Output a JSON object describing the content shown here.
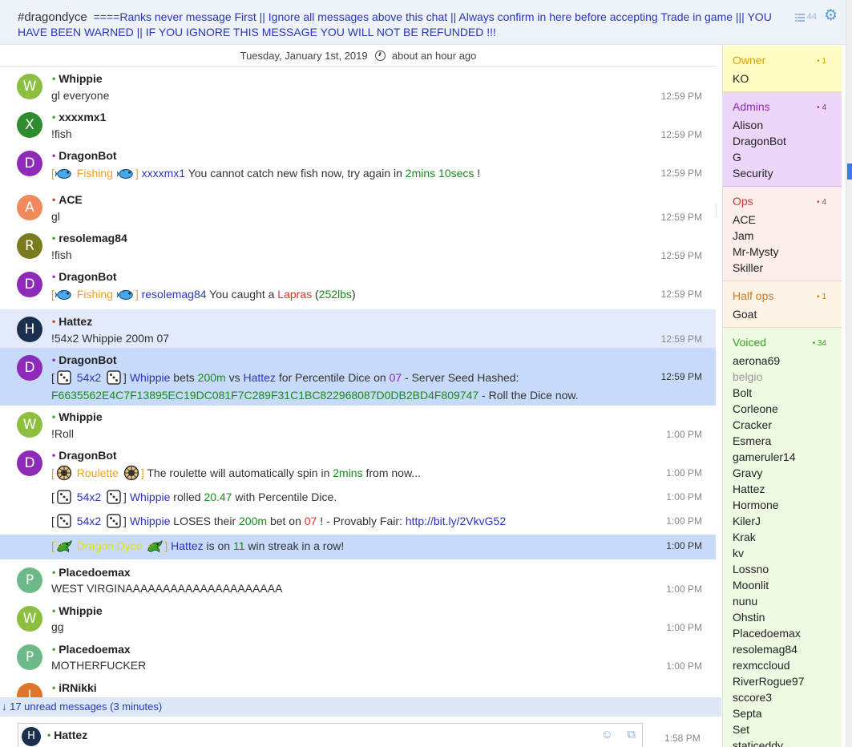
{
  "topic": {
    "channel": "#dragondyce",
    "text": "====Ranks never message First || Ignore all messages above this chat || Always confirm in here before accepting Trade in game ||| YOU HAVE BEEN WARNED || IF YOU IGNORE THIS MESSAGE YOU WILL NOT BE REFUNDED !!!",
    "user_count": "44"
  },
  "dateline": {
    "date": "Tuesday, January 1st, 2019",
    "relative": "about an hour ago"
  },
  "messages": {
    "m1": {
      "initial": "W",
      "nick": "Whippie",
      "text": "gl everyone",
      "time": "12:59 PM"
    },
    "m2": {
      "initial": "X",
      "nick": "xxxxmx1",
      "text": "!fish",
      "time": "12:59 PM"
    },
    "m3": {
      "initial": "D",
      "nick": "DragonBot",
      "tag": "Fishing",
      "user": "xxxxmx1",
      "text_a": "You cannot catch new fish now, try again in",
      "duration": "2mins 10secs",
      "text_b": "!",
      "time": "12:59 PM"
    },
    "m4": {
      "initial": "A",
      "nick": "ACE",
      "text": "gl",
      "time": "12:59 PM"
    },
    "m5": {
      "initial": "R",
      "nick": "resolemag84",
      "text": "!fish",
      "time": "12:59 PM"
    },
    "m6": {
      "initial": "D",
      "nick": "DragonBot",
      "tag": "Fishing",
      "user": "resolemag84",
      "text_a": "You caught a",
      "catch": "Lapras",
      "weight": "252lbs",
      "time": "12:59 PM"
    },
    "m7": {
      "initial": "H",
      "nick": "Hattez",
      "text": "!54x2 Whippie 200m 07",
      "time": "12:59 PM"
    },
    "m8": {
      "initial": "D",
      "nick": "DragonBot",
      "tag": "54x2",
      "user1": "Whippie",
      "bets": "bets",
      "amount": "200m",
      "vs": "vs",
      "user2": "Hattez",
      "for": "for Percentile Dice on",
      "num": "07",
      "seed_label": "- Server Seed Hashed:",
      "seed": "F6635562E4C7F13895EC19DC081F7C289F31C1BC822968087D0DB2BD4F809747",
      "tail": "- Roll the Dice now.",
      "time": "12:59 PM"
    },
    "m9": {
      "initial": "W",
      "nick": "Whippie",
      "text": "!Roll",
      "time": "1:00 PM"
    },
    "m10": {
      "initial": "D",
      "nick": "DragonBot",
      "tag": "Roulette",
      "text_a": "The roulette will automatically spin in",
      "duration": "2mins",
      "text_b": "from now...",
      "time": "1:00 PM"
    },
    "m10b": {
      "tag": "54x2",
      "user": "Whippie",
      "text_a": "rolled",
      "roll": "20.47",
      "text_b": "with Percentile Dice.",
      "time": "1:00 PM"
    },
    "m10c": {
      "tag": "54x2",
      "user": "Whippie",
      "text_a": "LOSES their",
      "amount": "200m",
      "text_b": "bet on",
      "num": "07",
      "text_c": "! - Provably Fair:",
      "link": "http://bit.ly/2VkvG52",
      "time": "1:00 PM"
    },
    "m10d": {
      "tag": "Dragon Dyce",
      "user": "Hattez",
      "text_a": "is on",
      "streak": "11",
      "text_b": "win streak in a row!",
      "time": "1:00 PM"
    },
    "m11": {
      "initial": "P",
      "nick": "Placedoemax",
      "text": "WEST VIRGINAAAAAAAAAAAAAAAAAAAAA",
      "time": "1:00 PM"
    },
    "m12": {
      "initial": "W",
      "nick": "Whippie",
      "text": "gg",
      "time": "1:00 PM"
    },
    "m13": {
      "initial": "P",
      "nick": "Placedoemax",
      "text": "MOTHERFUCKER",
      "time": "1:00 PM"
    },
    "m14": {
      "initial": "I",
      "nick": "iRNikki"
    }
  },
  "unread": "↓ 17 unread messages (3 minutes)",
  "input": {
    "initial": "H",
    "nick": "Hattez",
    "time": "1:58 PM"
  },
  "userlist": {
    "owner": {
      "label": "Owner",
      "count": "1",
      "users": [
        "KO"
      ]
    },
    "admins": {
      "label": "Admins",
      "count": "4",
      "users": [
        "Alison",
        "DragonBot",
        "G",
        "Security"
      ]
    },
    "ops": {
      "label": "Ops",
      "count": "4",
      "users": [
        "ACE",
        "Jam",
        "Mr-Mysty",
        "Skiller"
      ]
    },
    "halfops": {
      "label": "Half ops",
      "count": "1",
      "users": [
        "Goat"
      ]
    },
    "voiced": {
      "label": "Voiced",
      "count": "34",
      "users": [
        "aerona69",
        "belgio",
        "Bolt",
        "Corleone",
        "Cracker",
        "Esmera",
        "gameruler14",
        "Gravy",
        "Hattez",
        "Hormone",
        "KilerJ",
        "Krak",
        "kv",
        "Lossno",
        "Moonlit",
        "nunu",
        "Ohstin",
        "Placedoemax",
        "resolemag84",
        "rexmccloud",
        "RiverRogue97",
        "sccore3",
        "Septa",
        "Set",
        "staticeddy"
      ],
      "away": [
        "belgio"
      ]
    }
  },
  "colors": {
    "accent": "#2a35b8",
    "highlight": "#c8dafa",
    "owner_bg": "#fdfdc4",
    "admins_bg": "#ecd6f9",
    "ops_bg": "#fdeeec",
    "halfops_bg": "#fdf3e6",
    "voiced_bg": "#effae3"
  },
  "icons": [
    "list-icon",
    "gear-icon",
    "clock-icon",
    "fish-icon",
    "dice-icon",
    "roulette-icon",
    "dragon-icon",
    "emoji-icon",
    "paste-icon"
  ]
}
